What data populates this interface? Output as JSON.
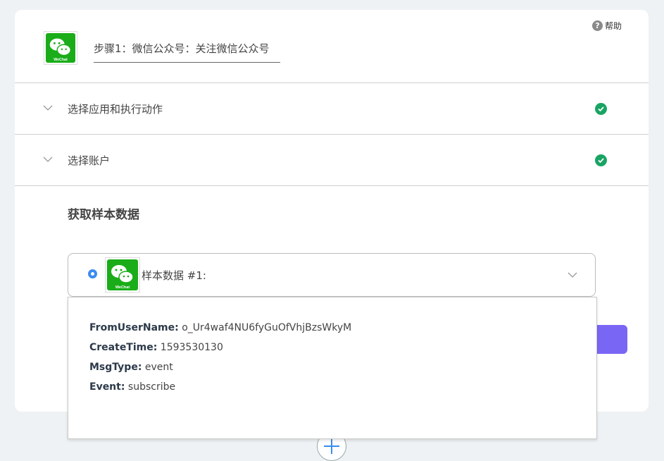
{
  "header": {
    "help_label": "帮助",
    "help_icon": "question-icon",
    "app_icon": "wechat-logo",
    "logo_text": "WeChat",
    "step_title": "步骤1：微信公众号：关注微信公众号"
  },
  "sections": [
    {
      "label": "选择应用和执行动作",
      "status": "complete"
    },
    {
      "label": "选择账户",
      "status": "complete"
    }
  ],
  "sample": {
    "title": "获取样本数据",
    "selected_label": "样本数据 #1:",
    "fields": [
      {
        "key": "FromUserName:",
        "value": "o_Ur4waf4NU6fyGuOfVhjBzsWkyM"
      },
      {
        "key": "CreateTime:",
        "value": "1593530130"
      },
      {
        "key": "MsgType:",
        "value": "event"
      },
      {
        "key": "Event:",
        "value": "subscribe"
      }
    ]
  },
  "colors": {
    "check": "#19a463",
    "accent": "#7a66f5",
    "radio": "#3b8cf0",
    "wechat": "#1aad19"
  }
}
